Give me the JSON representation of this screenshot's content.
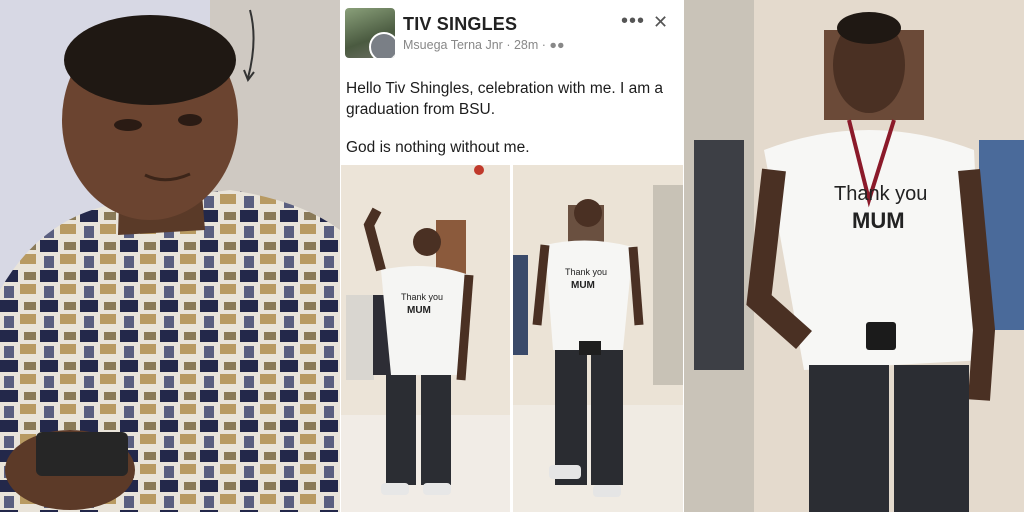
{
  "post": {
    "group_name": "TIV SINGLES",
    "author": "Msuega Terna Jnr",
    "time": "28m",
    "line1": "Hello Tiv Shingles, celebration with me. I am a graduation from BSU.",
    "line2": "God is nothing without me."
  },
  "shirt_text": {
    "line1": "Thank you",
    "line2": "MUM"
  },
  "icons": [
    "more-options-icon",
    "close-icon",
    "audience-icon"
  ],
  "colors": {
    "background": "#ffffff",
    "title": "#222222",
    "meta": "#888888",
    "text": "#1c1c1c"
  }
}
